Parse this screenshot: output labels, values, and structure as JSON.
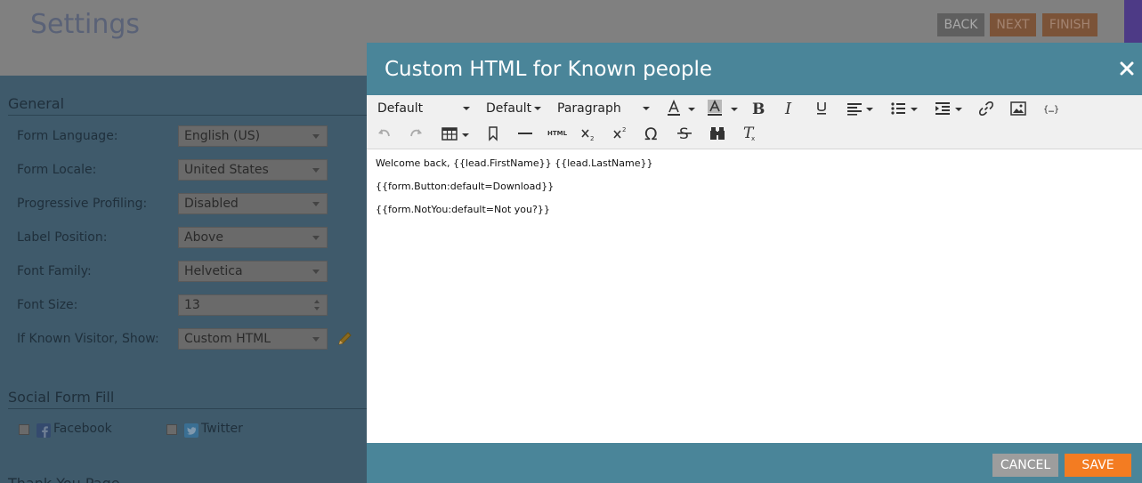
{
  "page": {
    "title": "Settings",
    "buttons": {
      "back": "BACK",
      "next": "NEXT",
      "finish": "FINISH"
    }
  },
  "general": {
    "section_title": "General",
    "fields": [
      {
        "label": "Form Language:",
        "value": "English (US)"
      },
      {
        "label": "Form Locale:",
        "value": "United States"
      },
      {
        "label": "Progressive Profiling:",
        "value": "Disabled"
      },
      {
        "label": "Label Position:",
        "value": "Above"
      },
      {
        "label": "Font Family:",
        "value": "Helvetica"
      },
      {
        "label": "Font Size:",
        "value": "13"
      },
      {
        "label": "If Known Visitor, Show:",
        "value": "Custom HTML"
      }
    ]
  },
  "social": {
    "section_title": "Social Form Fill",
    "facebook": "Facebook",
    "twitter": "Twitter"
  },
  "thank_you": {
    "section_title": "Thank You Page"
  },
  "modal": {
    "title": "Custom HTML for Known people",
    "toolbar": {
      "font_family": "Default",
      "font_size": "Default",
      "format": "Paragraph",
      "html_label": "HTML"
    },
    "editor_lines": [
      "Welcome back, {{lead.FirstName}} {{lead.LastName}}",
      "{{form.Button:default=Download}}",
      "{{form.NotYou:default=Not you?}}"
    ],
    "cancel": "CANCEL",
    "save": "SAVE"
  },
  "colors": {
    "modal_header": "#4a8599",
    "save_button": "#f37c22",
    "cancel_button": "#9d9d9d"
  }
}
